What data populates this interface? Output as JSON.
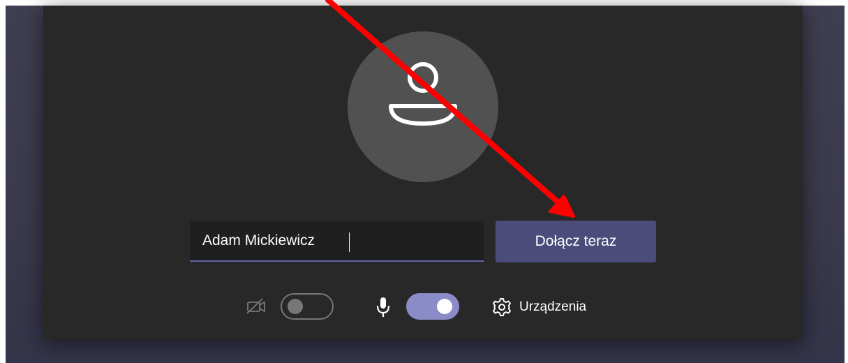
{
  "prejoin": {
    "name_value": "Adam Mickiewicz",
    "join_label": "Dołącz teraz",
    "devices_label": "Urządzenia",
    "camera_on": false,
    "mic_on": true
  },
  "icons": {
    "avatar": "person-icon",
    "camera": "camera-off-icon",
    "mic": "microphone-icon",
    "devices": "gear-icon",
    "annotation": "red-arrow"
  },
  "colors": {
    "panel": "#292828",
    "backdrop": "#3a3a4c",
    "accent": "#6264a7",
    "button": "#4b4c7a",
    "toggle_on": "#8b8cc7",
    "annotation_arrow": "#ff0000"
  }
}
